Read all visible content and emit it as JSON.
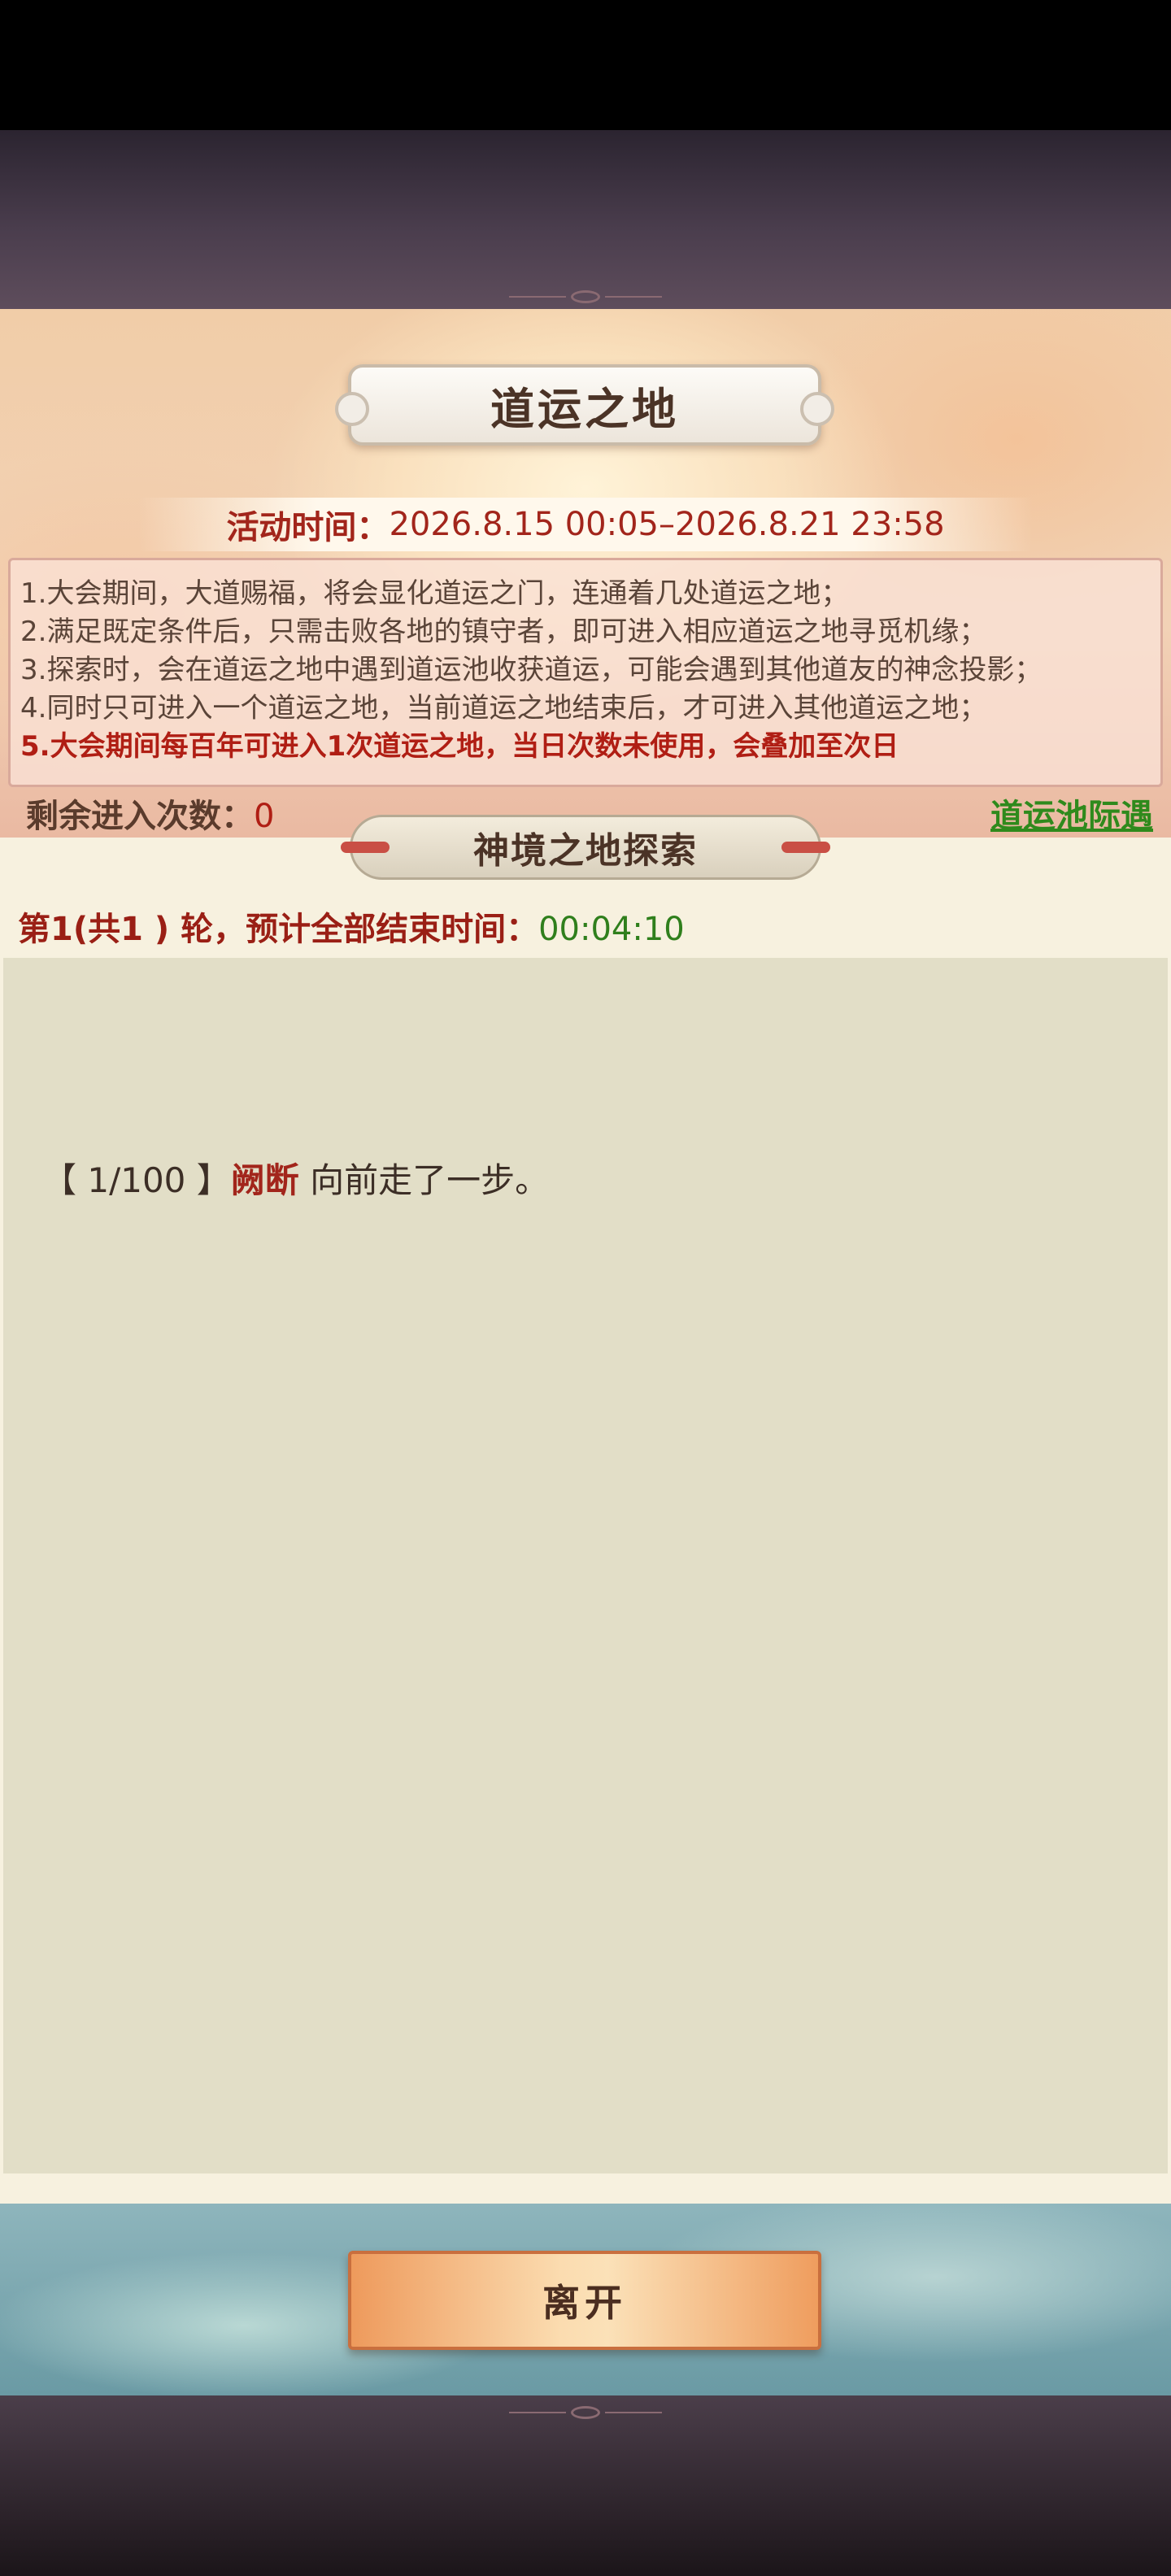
{
  "header": {
    "title": "道运之地",
    "activity_time_label": "活动时间：",
    "activity_time_value": "2026.8.15 00:05–2026.8.21 23:58"
  },
  "rules": [
    "1.大会期间，大道赐福，将会显化道运之门，连通着几处道运之地；",
    "2.满足既定条件后，只需击败各地的镇守者，即可进入相应道运之地寻觅机缘；",
    "3.探索时，会在道运之地中遇到道运池收获道运，可能会遇到其他道友的神念投影；",
    "4.同时只可进入一个道运之地，当前道运之地结束后，才可进入其他道运之地；",
    "5.大会期间每百年可进入1次道运之地，当日次数未使用，会叠加至次日"
  ],
  "status": {
    "remaining_label": "剩余进入次数：",
    "remaining_count": "0",
    "pool_link": "道运池际遇"
  },
  "explore": {
    "section_title": "神境之地探索",
    "round_text": "第1(共1 ) 轮，预计全部结束时间：",
    "round_timer": "00:04:10"
  },
  "log": [
    {
      "step": "【 1/100 】",
      "name": "阙断",
      "action": " 向前走了一步。"
    }
  ],
  "footer": {
    "leave_label": "离开"
  },
  "colors": {
    "accent_red": "#b01e14",
    "link_green": "#2f8a1c",
    "timer_green": "#2f7f1c",
    "button_orange": "#ee9a5c"
  }
}
